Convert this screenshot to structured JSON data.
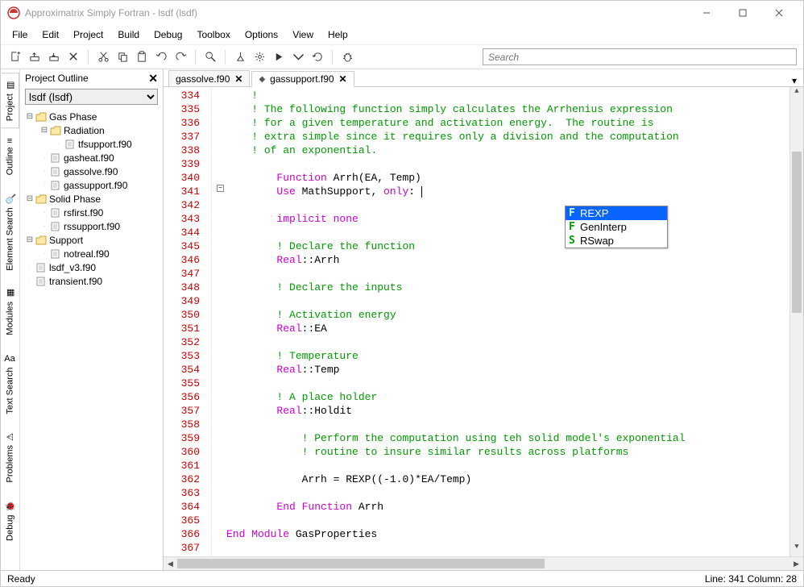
{
  "title": "Approximatrix Simply Fortran - lsdf (lsdf)",
  "menu": [
    "File",
    "Edit",
    "Project",
    "Build",
    "Debug",
    "Toolbox",
    "Options",
    "View",
    "Help"
  ],
  "search_placeholder": "Search",
  "sidetabs": [
    "Project",
    "Outline",
    "Element Search",
    "Modules",
    "Text Search",
    "Problems",
    "Debug"
  ],
  "outline": {
    "title": "Project Outline",
    "selector": "lsdf (lsdf)",
    "tree": [
      {
        "d": 0,
        "t": "Gas Phase",
        "exp": true,
        "kind": "folder"
      },
      {
        "d": 1,
        "t": "Radiation",
        "exp": true,
        "kind": "folder"
      },
      {
        "d": 2,
        "t": "tfsupport.f90",
        "kind": "file"
      },
      {
        "d": 1,
        "t": "gasheat.f90",
        "kind": "file"
      },
      {
        "d": 1,
        "t": "gassolve.f90",
        "kind": "file"
      },
      {
        "d": 1,
        "t": "gassupport.f90",
        "kind": "file"
      },
      {
        "d": 0,
        "t": "Solid Phase",
        "exp": true,
        "kind": "folder"
      },
      {
        "d": 1,
        "t": "rsfirst.f90",
        "kind": "file"
      },
      {
        "d": 1,
        "t": "rssupport.f90",
        "kind": "file"
      },
      {
        "d": 0,
        "t": "Support",
        "exp": true,
        "kind": "folder"
      },
      {
        "d": 1,
        "t": "notreal.f90",
        "kind": "file"
      },
      {
        "d": 0,
        "t": "lsdf_v3.f90",
        "kind": "file"
      },
      {
        "d": 0,
        "t": "transient.f90",
        "kind": "file"
      }
    ]
  },
  "tabs": [
    {
      "label": "gassolve.f90",
      "active": false,
      "dirty": false
    },
    {
      "label": "gassupport.f90",
      "active": true,
      "dirty": true
    }
  ],
  "code": {
    "first_line": 334,
    "lines": [
      [
        [
          "cmt",
          "!"
        ]
      ],
      [
        [
          "cmt",
          "! The following function simply calculates the Arrhenius expression"
        ]
      ],
      [
        [
          "cmt",
          "! for a given temperature and activation energy.  The routine is"
        ]
      ],
      [
        [
          "cmt",
          "! extra simple since it requires only a division and the computation"
        ]
      ],
      [
        [
          "cmt",
          "! of an exponential."
        ]
      ],
      [],
      [
        [
          "kw",
          "Function"
        ],
        [
          "id",
          " Arrh(EA, Temp)"
        ]
      ],
      [
        [
          "kw",
          "Use"
        ],
        [
          "id",
          " MathSupport, "
        ],
        [
          "kw",
          "only"
        ],
        [
          "id",
          ": "
        ],
        [
          "cursor",
          ""
        ]
      ],
      [],
      [
        [
          "kw",
          "implicit none"
        ]
      ],
      [],
      [
        [
          "cmt",
          "! Declare the function"
        ]
      ],
      [
        [
          "kw",
          "Real"
        ],
        [
          "id",
          "::Arrh"
        ]
      ],
      [],
      [
        [
          "cmt",
          "! Declare the inputs"
        ]
      ],
      [],
      [
        [
          "cmt",
          "! Activation energy"
        ]
      ],
      [
        [
          "kw",
          "Real"
        ],
        [
          "id",
          "::EA"
        ]
      ],
      [],
      [
        [
          "cmt",
          "! Temperature"
        ]
      ],
      [
        [
          "kw",
          "Real"
        ],
        [
          "id",
          "::Temp"
        ]
      ],
      [],
      [
        [
          "cmt",
          "! A place holder"
        ]
      ],
      [
        [
          "kw",
          "Real"
        ],
        [
          "id",
          "::Holdit"
        ]
      ],
      [],
      [
        [
          "cmt",
          "    ! Perform the computation using teh solid model's exponential"
        ]
      ],
      [
        [
          "cmt",
          "    ! routine to insure similar results across platforms"
        ]
      ],
      [],
      [
        [
          "id",
          "    Arrh = REXP(("
        ],
        [
          "id",
          "-1.0"
        ],
        [
          "id",
          ")*EA/Temp)"
        ]
      ],
      [],
      [
        [
          "kw",
          "End Function"
        ],
        [
          "id",
          " Arrh"
        ]
      ],
      [],
      [
        [
          "kw",
          "End Module"
        ],
        [
          "id",
          " GasProperties"
        ]
      ],
      []
    ],
    "indent_outer": "    ",
    "indent_inner": "        "
  },
  "autocomplete": [
    {
      "glyph": "F",
      "label": "REXP",
      "sel": true
    },
    {
      "glyph": "F",
      "label": "GenInterp",
      "sel": false
    },
    {
      "glyph": "S",
      "label": "RSwap",
      "sel": false
    }
  ],
  "status": {
    "left": "Ready",
    "right": "Line: 341 Column: 28"
  }
}
